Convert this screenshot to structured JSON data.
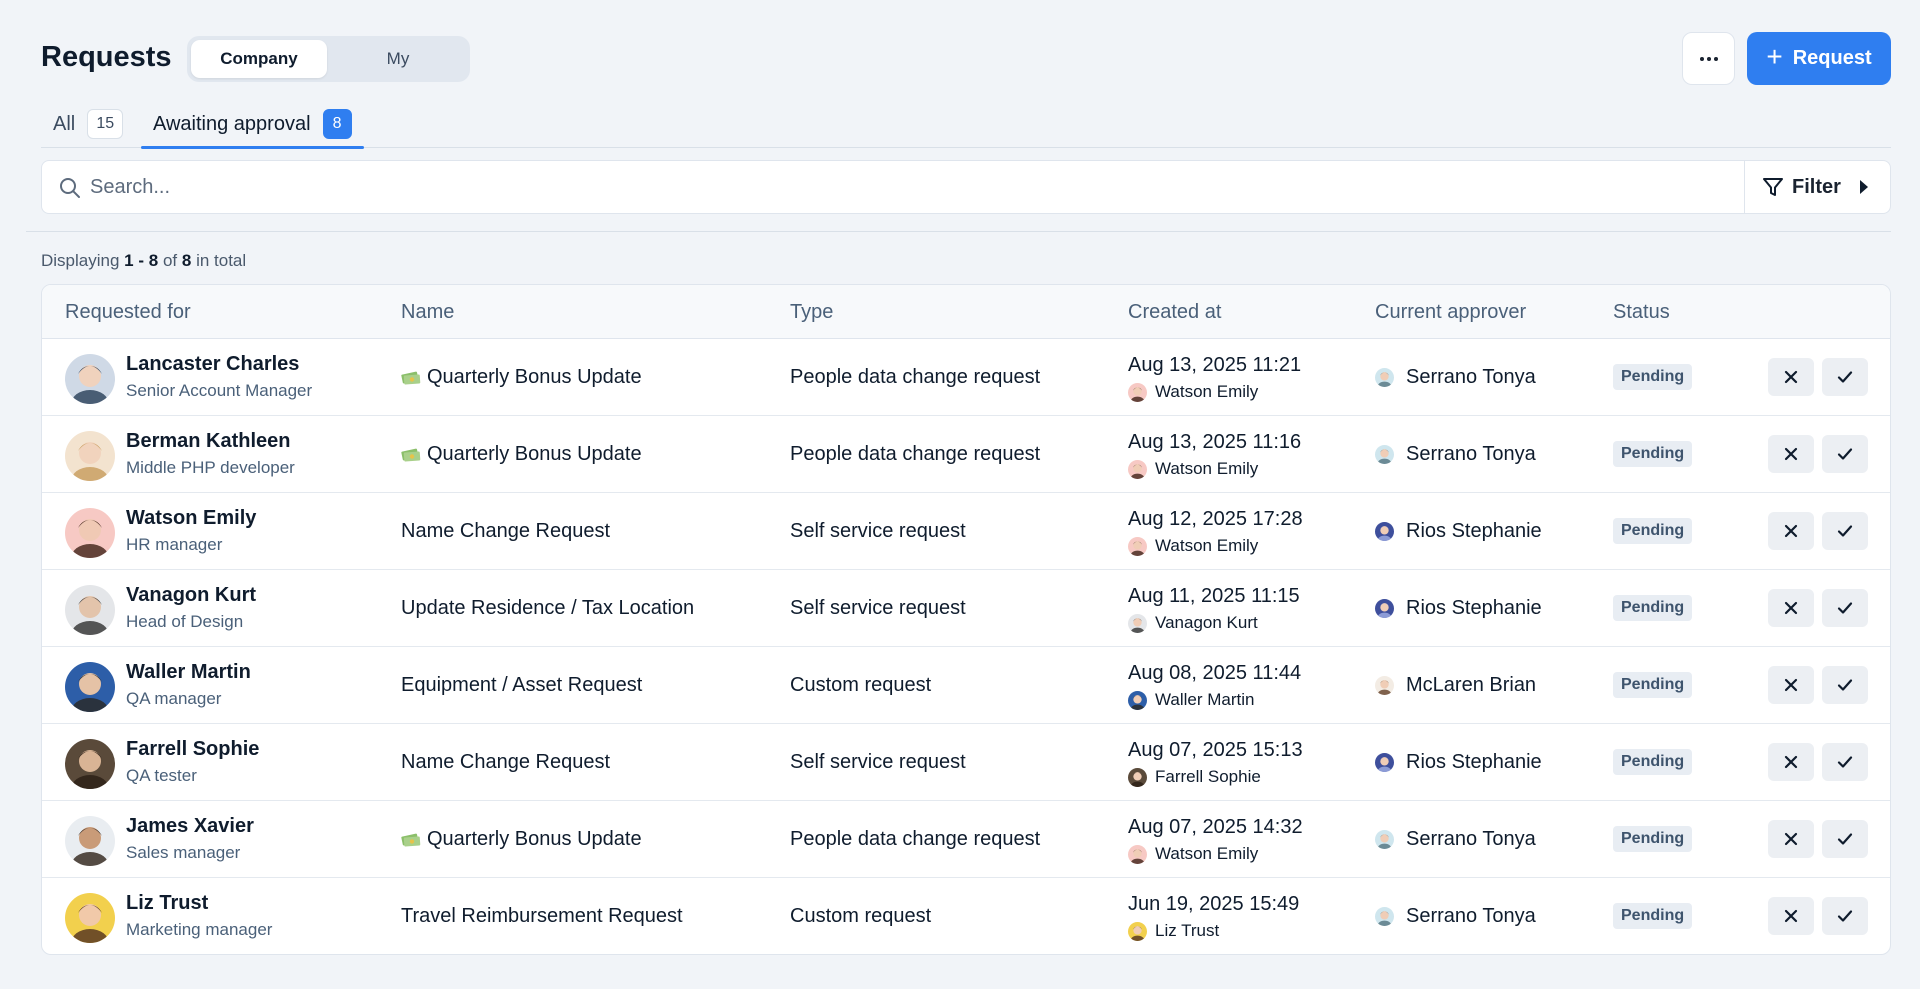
{
  "header": {
    "title": "Requests",
    "scope_tabs": [
      {
        "label": "Company",
        "active": true
      },
      {
        "label": "My",
        "active": false
      }
    ],
    "more_icon": "ellipsis-icon",
    "request_button": "Request"
  },
  "tabs": [
    {
      "label": "All",
      "count": "15",
      "active": false
    },
    {
      "label": "Awaiting approval",
      "count": "8",
      "active": true
    }
  ],
  "search": {
    "placeholder": "Search...",
    "value": ""
  },
  "filter": {
    "label": "Filter"
  },
  "display": {
    "prefix": "Displaying",
    "range": "1 - 8",
    "of": "of",
    "total": "8",
    "suffix": "in total"
  },
  "colors": {
    "accent": "#2f7ef0",
    "background": "#f1f4f8",
    "status_badge": "#e8edf3"
  },
  "table": {
    "columns": [
      "Requested for",
      "Name",
      "Type",
      "Created at",
      "Current approver",
      "Status"
    ],
    "rows": [
      {
        "person": "Lancaster Charles",
        "role": "Senior Account Manager",
        "name": "Quarterly Bonus Update",
        "money_icon": true,
        "type": "People data change request",
        "created_at": "Aug 13, 2025 11:21",
        "created_by": "Watson Emily",
        "approver": "Serrano Tonya",
        "status": "Pending"
      },
      {
        "person": "Berman Kathleen",
        "role": "Middle PHP developer",
        "name": "Quarterly Bonus Update",
        "money_icon": true,
        "type": "People data change request",
        "created_at": "Aug 13, 2025 11:16",
        "created_by": "Watson Emily",
        "approver": "Serrano Tonya",
        "status": "Pending"
      },
      {
        "person": "Watson Emily",
        "role": "HR manager",
        "name": "Name Change Request",
        "money_icon": false,
        "type": "Self service request",
        "created_at": "Aug 12, 2025 17:28",
        "created_by": "Watson Emily",
        "approver": "Rios Stephanie",
        "status": "Pending"
      },
      {
        "person": "Vanagon Kurt",
        "role": "Head of Design",
        "name": "Update Residence / Tax Location",
        "money_icon": false,
        "type": "Self service request",
        "created_at": "Aug 11, 2025 11:15",
        "created_by": "Vanagon Kurt",
        "approver": "Rios Stephanie",
        "status": "Pending"
      },
      {
        "person": "Waller Martin",
        "role": "QA manager",
        "name": "Equipment / Asset Request",
        "money_icon": false,
        "type": "Custom request",
        "created_at": "Aug 08, 2025 11:44",
        "created_by": "Waller Martin",
        "approver": "McLaren Brian",
        "status": "Pending"
      },
      {
        "person": "Farrell Sophie",
        "role": "QA tester",
        "name": "Name Change Request",
        "money_icon": false,
        "type": "Self service request",
        "created_at": "Aug 07, 2025 15:13",
        "created_by": "Farrell Sophie",
        "approver": "Rios Stephanie",
        "status": "Pending"
      },
      {
        "person": "James Xavier",
        "role": "Sales manager",
        "name": "Quarterly Bonus Update",
        "money_icon": true,
        "type": "People data change request",
        "created_at": "Aug 07, 2025 14:32",
        "created_by": "Watson Emily",
        "approver": "Serrano Tonya",
        "status": "Pending"
      },
      {
        "person": "Liz Trust",
        "role": "Marketing manager",
        "name": "Travel Reimbursement Request",
        "money_icon": false,
        "type": "Custom request",
        "created_at": "Jun 19, 2025 15:49",
        "created_by": "Liz Trust",
        "approver": "Serrano Tonya",
        "status": "Pending"
      }
    ]
  }
}
